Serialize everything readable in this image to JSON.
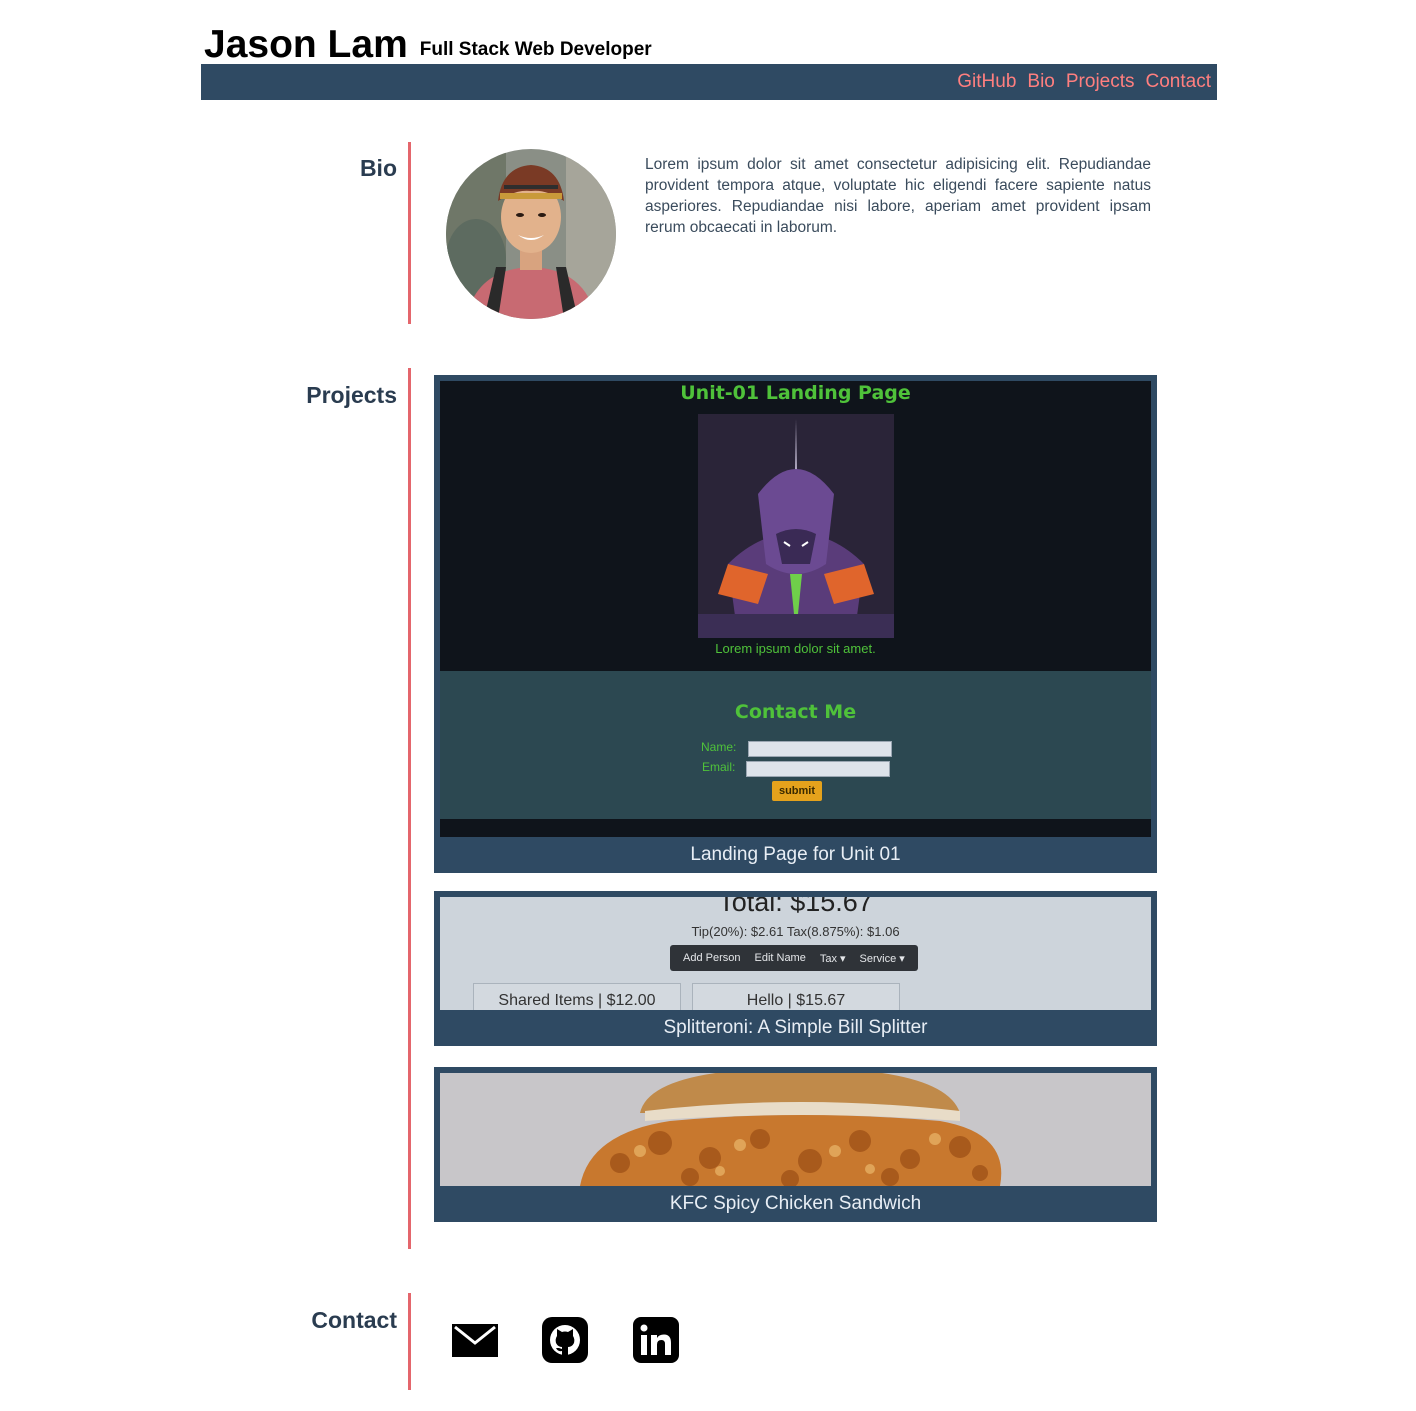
{
  "header": {
    "name": "Jason Lam",
    "subtitle": "Full Stack Web Developer",
    "nav": [
      "GitHub",
      "Bio",
      "Projects",
      "Contact"
    ]
  },
  "sections": {
    "bio": "Bio",
    "projects": "Projects",
    "contact": "Contact"
  },
  "bio": {
    "text": "Lorem ipsum dolor sit amet consectetur adipisicing elit. Repudiandae provident tempora atque, voluptate hic eligendi facere sapiente natus asperiores. Repudiandae nisi labore, aperiam amet provident ipsam rerum obcaecati in laborum."
  },
  "projects": [
    {
      "caption": "Landing Page for Unit 01",
      "preview": {
        "title": "Unit-01 Landing Page",
        "image_caption": "Lorem ipsum dolor sit amet.",
        "contact_title": "Contact Me",
        "name_label": "Name:",
        "email_label": "Email:",
        "submit_label": "submit"
      }
    },
    {
      "caption": "Splitteroni: A Simple Bill Splitter",
      "preview": {
        "total": "Total: $15.67",
        "tips": "Tip(20%): $2.61 Tax(8.875%): $1.06",
        "toolbar": [
          "Add Person",
          "Edit Name",
          "Tax ▾",
          "Service ▾"
        ],
        "boxes": [
          "Shared Items | $12.00",
          "Hello | $15.67"
        ]
      }
    },
    {
      "caption": "KFC Spicy Chicken Sandwich"
    }
  ],
  "contact": {
    "icons": [
      "mail-icon",
      "github-icon",
      "linkedin-icon"
    ]
  },
  "colors": {
    "navbar": "#2f4a63",
    "nav_link": "#ff7f7f",
    "section_rule": "#e4666c",
    "unit01_green": "#4fc23a"
  }
}
